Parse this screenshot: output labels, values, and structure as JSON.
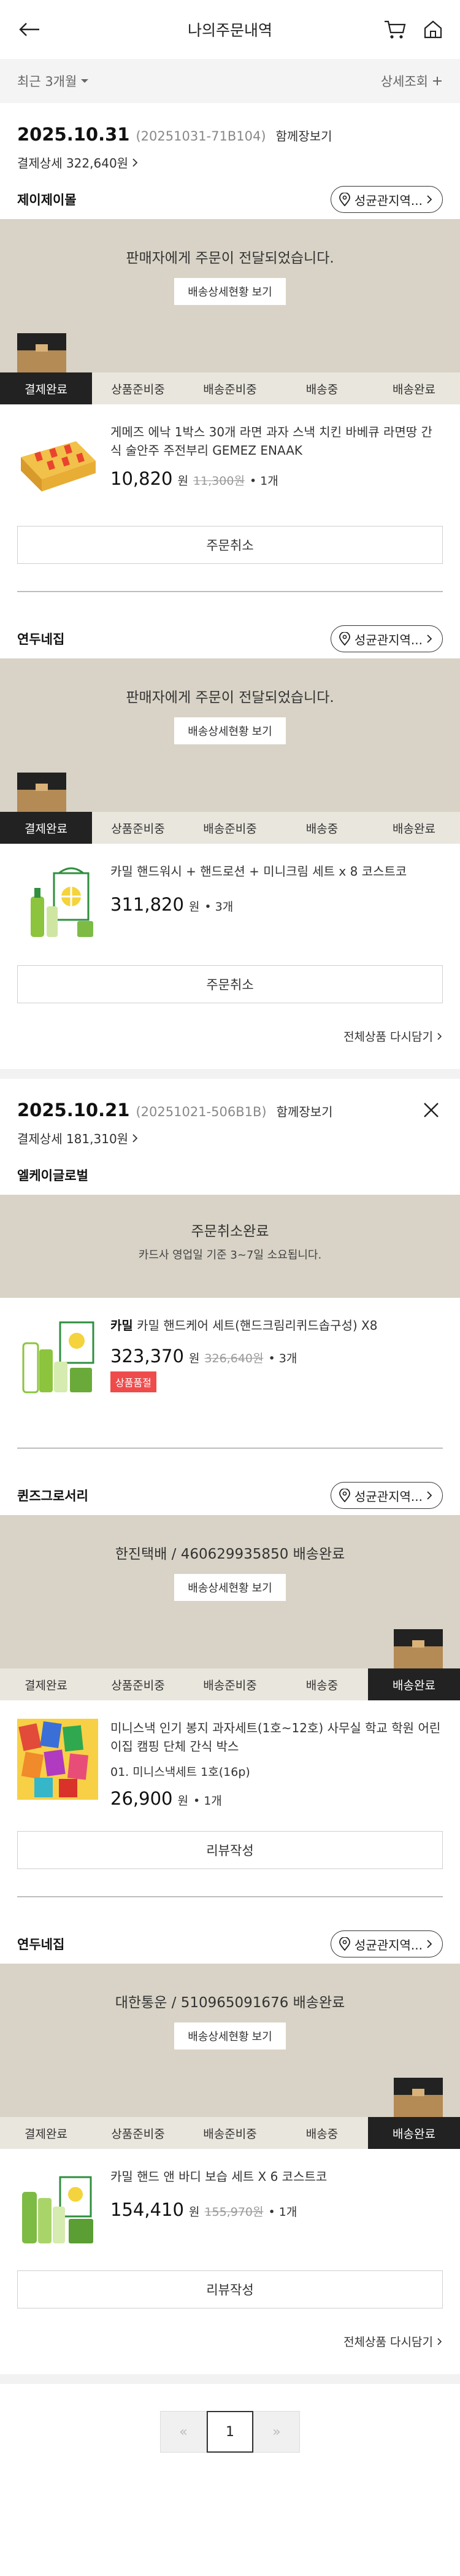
{
  "header": {
    "title": "나의주문내역"
  },
  "filter": {
    "period": "최근 3개월",
    "detail": "상세조회"
  },
  "orders": [
    {
      "date": "2025.10.31",
      "order_no": "(20251031-71B104)",
      "together_label": "함께장보기",
      "payment_label": "결제상세 322,640원",
      "shipments": [
        {
          "seller": "제이제이몰",
          "store_label": "성균관지역...",
          "status_msg": "판매자에게 주문이 전달되었습니다.",
          "status_btn": "배송상세현황 보기",
          "steps": [
            "결제완료",
            "상품준비중",
            "배송준비중",
            "배송중",
            "배송완료"
          ],
          "active_step": 0,
          "product": {
            "name": "게메즈 에낙 1박스 30개 라면 과자 스낵 치킨 바베큐 라면땅 간식 술안주 주전부리 GEMEZ ENAAK",
            "price": "10,820",
            "won": "원",
            "orig": "11,300원",
            "qty": "• 1개"
          },
          "action": "주문취소"
        },
        {
          "seller": "연두네집",
          "store_label": "성균관지역...",
          "status_msg": "판매자에게 주문이 전달되었습니다.",
          "status_btn": "배송상세현황 보기",
          "steps": [
            "결제완료",
            "상품준비중",
            "배송준비중",
            "배송중",
            "배송완료"
          ],
          "active_step": 0,
          "product": {
            "name": "카밀 핸드워시 + 핸드로션 + 미니크림 세트 x 8 코스트코",
            "price": "311,820",
            "won": "원",
            "qty": "• 3개"
          },
          "action": "주문취소"
        }
      ],
      "reorder": "전체상품 다시담기"
    },
    {
      "date": "2025.10.21",
      "order_no": "(20251021-506B1B)",
      "together_label": "함께장보기",
      "payment_label": "결제상세 181,310원",
      "cancel_shipment": {
        "seller": "엘케이글로벌",
        "status_msg": "주문취소완료",
        "status_sub": "카드사 영업일 기준 3~7일 소요됩니다.",
        "product": {
          "brand": "카밀",
          "name": "카밀 핸드케어 세트(핸드크림리퀴드솝구성) X8",
          "price": "323,370",
          "won": "원",
          "orig": "326,640원",
          "qty": "• 3개",
          "badge": "상품품절"
        }
      },
      "shipments": [
        {
          "seller": "퀸즈그로서리",
          "store_label": "성균관지역...",
          "status_msg": "한진택배 / 460629935850 배송완료",
          "status_btn": "배송상세현황 보기",
          "steps": [
            "결제완료",
            "상품준비중",
            "배송준비중",
            "배송중",
            "배송완료"
          ],
          "active_step": 4,
          "product": {
            "name": "미니스낵 인기 봉지 과자세트(1호~12호) 사무실 학교 학원 어린이집 캠핑 단체 간식 박스",
            "option": "01. 미니스낵세트 1호(16p)",
            "price": "26,900",
            "won": "원",
            "qty": "• 1개"
          },
          "action": "리뷰작성"
        },
        {
          "seller": "연두네집",
          "store_label": "성균관지역...",
          "status_msg": "대한통운 / 510965091676 배송완료",
          "status_btn": "배송상세현황 보기",
          "steps": [
            "결제완료",
            "상품준비중",
            "배송준비중",
            "배송중",
            "배송완료"
          ],
          "active_step": 4,
          "product": {
            "name": "카밀 핸드 앤 바디 보습 세트 X 6 코스트코",
            "price": "154,410",
            "won": "원",
            "orig": "155,970원",
            "qty": "• 1개"
          },
          "action": "리뷰작성"
        }
      ],
      "reorder": "전체상품 다시담기"
    }
  ],
  "pagination": {
    "prev": "«",
    "current": "1",
    "next": "»"
  }
}
